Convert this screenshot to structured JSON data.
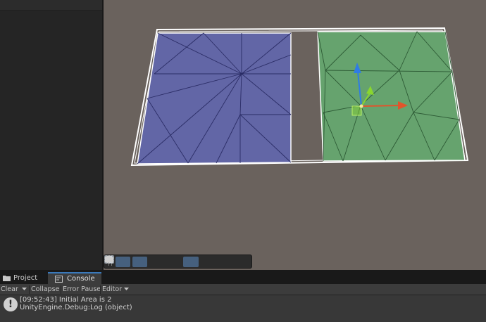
{
  "tabs": [
    {
      "label": "Project",
      "icon": "folder-icon",
      "active": false
    },
    {
      "label": "Console",
      "icon": "console-icon",
      "active": true
    }
  ],
  "console_toolbar": {
    "clear": "Clear",
    "collapse": "Collapse",
    "error_pause": "Error Pause",
    "editor": "Editor"
  },
  "log": {
    "icon": "info-icon",
    "line1": "[09:52:43] Initial Area is 2",
    "line2": "UnityEngine.Debug:Log (object)"
  },
  "scene_tools": [
    "hand-tool-icon",
    "rect-tool-icon",
    "grid-icon",
    "shading-icon",
    "gizmos-icon",
    "search-icon",
    "move-view-icon",
    "camera-icon"
  ],
  "colors": {
    "scene_bg": "#6a625d",
    "blue_plane": "#6266a6",
    "green_plane": "#66a36e",
    "gizmo_x": "#e1542b",
    "gizmo_y": "#8ad62e",
    "gizmo_z": "#2f7ce5",
    "tab_accent": "#3a79bb"
  }
}
